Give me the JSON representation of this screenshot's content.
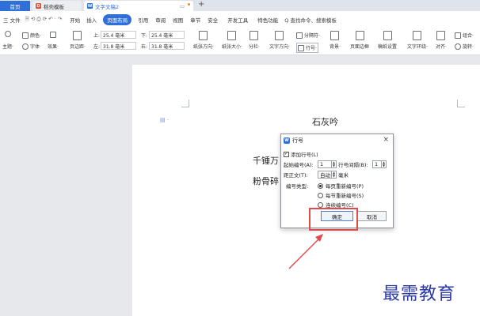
{
  "tabs": {
    "home": "首页",
    "template": "稻壳模板",
    "doc": "文字文稿2",
    "add": "+"
  },
  "menu": {
    "file": "三 文件",
    "start": "开始",
    "insert": "插入",
    "page_layout": "页面布局",
    "reference": "引用",
    "review": "审阅",
    "view": "视图",
    "section": "章节",
    "security": "安全",
    "dev_tools": "开发工具",
    "special": "特色功能",
    "search": "Q 查找命令、搜索模板"
  },
  "toolbar": {
    "theme": "主题·",
    "color": "颜色·",
    "font": "字体·",
    "effect": "效果·",
    "margin": "页边距·",
    "top_label": "上:",
    "top_value": "25.4 毫米",
    "bottom_label": "下:",
    "bottom_value": "25.4 毫米",
    "left_label": "左:",
    "left_value": "31.8 毫米",
    "right_label": "右:",
    "right_value": "31.8 毫米",
    "orientation": "纸张方向·",
    "size": "纸张大小·",
    "columns": "分栏·",
    "text_direction": "文字方向·",
    "line_number": "行号·",
    "separator": "分隔符·",
    "background": "背景·",
    "page_border": "页面边框",
    "manuscript": "稿纸设置",
    "wrap": "文字环绕·",
    "align": "对齐·",
    "rotate": "旋转·",
    "group": "组合·"
  },
  "document": {
    "title": "石灰吟",
    "line1": "千锤万",
    "line2": "粉骨碎"
  },
  "dialog": {
    "title": "行号",
    "add_line_numbers": "添加行号(L)",
    "start_label": "起始编号(A):",
    "start_value": "1",
    "interval_label": "行号间隔(B):",
    "interval_value": "1",
    "distance_label": "距正文(T):",
    "distance_value": "自动",
    "distance_unit": "毫米",
    "type_label": "编号类型:",
    "opt_restart_page": "每页重新编号(P)",
    "opt_restart_section": "每节重新编号(S)",
    "opt_continuous": "连续编号(C)",
    "ok": "确定",
    "cancel": "取消",
    "close": "×"
  },
  "watermark": "最需教育",
  "colors": {
    "accent": "#2f6fd8",
    "highlight": "#e04c4c",
    "watermark": "#2b3aa8"
  }
}
